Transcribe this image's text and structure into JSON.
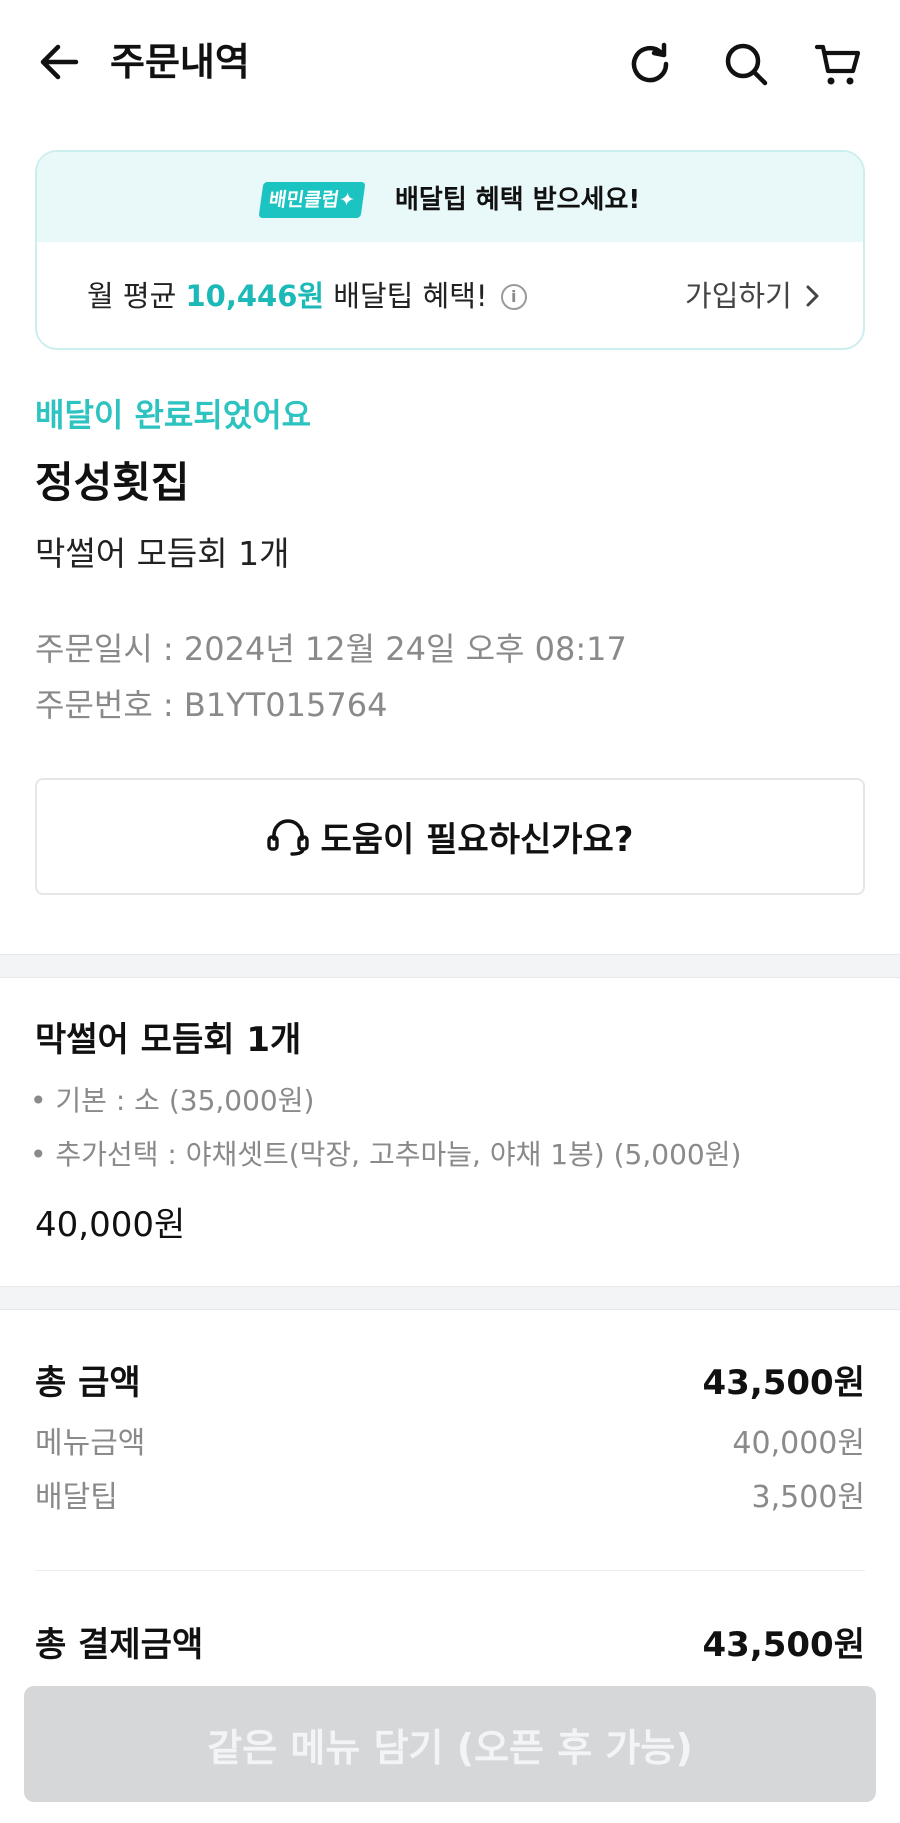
{
  "header": {
    "title": "주문내역",
    "icons": [
      "back-arrow-icon",
      "refresh-icon",
      "search-icon",
      "cart-icon"
    ]
  },
  "promo": {
    "badge": "배민클럽✦",
    "headline": "배달팁 혜택 받으세요!",
    "line_prefix": "월 평균 ",
    "amount": "10,446원",
    "line_suffix": " 배달팁 혜택!",
    "info_glyph": "i",
    "join_label": "가입하기",
    "accent_color": "#1bb9b7"
  },
  "order": {
    "status": "배달이 완료되었어요",
    "store_name": "정성횟집",
    "summary": "막썰어 모듬회 1개",
    "date_label": "주문일시 : 2024년 12월 24일 오후 08:17",
    "number_label": "주문번호 : B1YT015764"
  },
  "help": {
    "label": "도움이 필요하신가요?"
  },
  "item": {
    "title": "막썰어 모듬회 1개",
    "options": [
      "• 기본 : 소 (35,000원)",
      "• 추가선택 : 야채셋트(막장, 고추마늘, 야채 1봉) (5,000원)"
    ],
    "price": "40,000원"
  },
  "payment": {
    "total_label": "총 금액",
    "total_value": "43,500원",
    "menu_label": "메뉴금액",
    "menu_value": "40,000원",
    "tip_label": "배달팁",
    "tip_value": "3,500원",
    "grand_label": "총 결제금액",
    "grand_value": "43,500원"
  },
  "bottom_button": {
    "label": "같은 메뉴 담기 (오픈 후 가능)"
  }
}
